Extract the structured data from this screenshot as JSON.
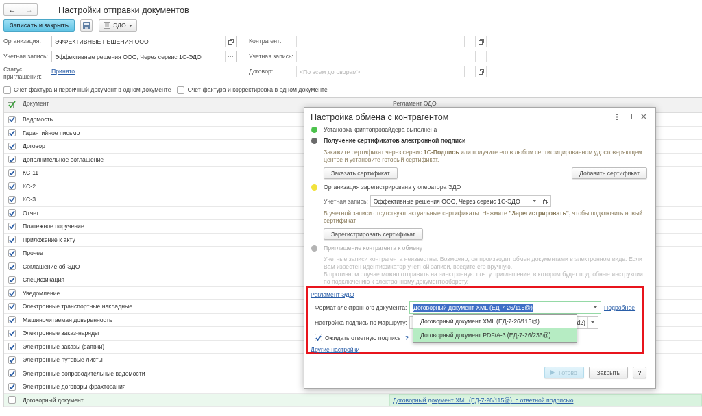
{
  "window": {
    "title": "Настройки отправки документов",
    "nav": [
      {
        "label": "←",
        "disabled": false
      },
      {
        "label": "→",
        "disabled": true
      }
    ]
  },
  "toolbar": [
    {
      "kind": "primary",
      "label": "Записать и закрыть"
    },
    {
      "kind": "save"
    },
    {
      "kind": "menu",
      "label": "ЭДО"
    }
  ],
  "form": {
    "left": [
      {
        "kind": "field",
        "label": "Организация:",
        "value": "ЭФФЕКТИВНЫЕ РЕШЕНИЯ ООО",
        "buttons": [
          {
            "kind": "open"
          }
        ]
      },
      {
        "kind": "field",
        "label": "Учетная запись:",
        "value": "Эффективные решения ООО, Через сервис 1С-ЭДО",
        "buttons": [
          {
            "kind": "more"
          }
        ]
      },
      {
        "kind": "link",
        "label": "Статус приглашения:",
        "link": "Принято"
      }
    ],
    "right": [
      {
        "kind": "field",
        "label": "Контрагент:",
        "buttons": [
          {
            "kind": "more"
          },
          {
            "kind": "open"
          }
        ]
      },
      {
        "kind": "field",
        "label": "Учетная запись:",
        "buttons": [
          {
            "kind": "more"
          }
        ]
      },
      {
        "kind": "field",
        "label": "Договор:",
        "placeholder": "<По всем договорам>",
        "buttons": [
          {
            "kind": "more"
          },
          {
            "kind": "open"
          }
        ]
      }
    ]
  },
  "options": [
    {
      "label": "Счет-фактура и первичный документ в одном документе",
      "checked": false
    },
    {
      "label": "Счет-фактура и корректировка в одном документе",
      "checked": false
    }
  ],
  "table": {
    "columns": [
      "Документ",
      "Регламент ЭДО"
    ],
    "rows": [
      {
        "document": "Ведомость",
        "checked": true,
        "selected": false
      },
      {
        "document": "Гарантийное письмо",
        "checked": true,
        "selected": false
      },
      {
        "document": "Договор",
        "checked": true,
        "selected": false
      },
      {
        "document": "Дополнительное соглашение",
        "checked": true,
        "selected": false
      },
      {
        "document": "КС-11",
        "checked": true,
        "selected": false
      },
      {
        "document": "КС-2",
        "checked": true,
        "selected": false
      },
      {
        "document": "КС-3",
        "checked": true,
        "selected": false
      },
      {
        "document": "Отчет",
        "checked": true,
        "selected": false
      },
      {
        "document": "Платежное поручение",
        "checked": true,
        "selected": false
      },
      {
        "document": "Приложение к акту",
        "checked": true,
        "selected": false
      },
      {
        "document": "Прочее",
        "checked": true,
        "selected": false
      },
      {
        "document": "Соглашение об ЭДО",
        "checked": true,
        "selected": false
      },
      {
        "document": "Спецификация",
        "checked": true,
        "selected": false
      },
      {
        "document": "Уведомление",
        "checked": true,
        "selected": false
      },
      {
        "document": "Электронные транспортные накладные",
        "checked": true,
        "selected": false
      },
      {
        "document": "Машиночитаемая доверенность",
        "checked": true,
        "selected": false
      },
      {
        "document": "Электронные заказ-наряды",
        "checked": true,
        "selected": false
      },
      {
        "document": "Электронные заказы (заявки)",
        "checked": true,
        "selected": false
      },
      {
        "document": "Электронные путевые листы",
        "checked": true,
        "selected": false
      },
      {
        "document": "Электронные сопроводительные ведомости",
        "checked": true,
        "selected": false
      },
      {
        "document": "Электронные договоры фрахтования",
        "checked": true,
        "selected": false
      },
      {
        "document": "Договорный документ",
        "checked": false,
        "selected": true,
        "regulation": "Договорный документ XML (ЕД-7-26/115@), с ответной подписью"
      }
    ]
  },
  "dialog": {
    "title": "Настройка обмена с контрагентом",
    "steps": [
      {
        "title": "Установка криптопровайдера выполнена",
        "color": "#4cc24c",
        "current": false,
        "disabled": false
      },
      {
        "title": "Получение сертификатов электронной подписи",
        "color": "#6b6b6b",
        "current": true,
        "disabled": false,
        "paragraphs": [
          "Закажите сертификат через сервис **1С-Подпись** или получите его в любом сертифицированном удостоверяющем центре и установите готовый сертификат."
        ],
        "buttons": [
          "Заказать сертификат",
          "Добавить сертификат"
        ]
      },
      {
        "title": "Организация зарегистрирована у оператора ЭДО",
        "color": "#f2e23c",
        "current": false,
        "disabled": false,
        "account": {
          "label": "Учетная запись:",
          "value": "Эффективные решения ООО, Через сервис 1С-ЭДО",
          "buttons": [
            {
              "kind": "dropdown"
            },
            {
              "kind": "open"
            }
          ]
        },
        "paragraphs": [
          "В учетной записи отсутствуют актуальные сертификаты. Нажмите **\"Зарегистрировать\",** чтобы подключить новый сертификат."
        ],
        "buttons": [
          "Зарегистрировать сертификат"
        ]
      },
      {
        "title": "Приглашение контрагента к обмену",
        "color": "#b4b4b4",
        "current": false,
        "disabled": true,
        "paragraphs": [
          "Учетные записи контрагента неизвестны. Возможно, он производит обмен документами в электронном виде. Если Вам известен идентификатор учетной записи, введите его вручную.",
          "В противном случае можно отправить на электронную почту приглашение, в котором будет подробные инструкции по подключению к электронному документообороту."
        ]
      }
    ],
    "regulation": {
      "link": "Регламент ЭДО",
      "format": {
        "label": "Формат электронного документа:",
        "value": "Договорный документ XML (ЕД-7-26/115@)",
        "focused": true,
        "buttons": [
          {
            "kind": "dropdown"
          }
        ],
        "more": "Подробнее"
      },
      "route": {
        "label": "Настройка подпись по маршруту:",
        "value": "d2)",
        "buttons": [
          {
            "kind": "dropdown"
          }
        ]
      },
      "wait": {
        "label": "Ожидать ответную подпись",
        "checked": true,
        "help": "?"
      },
      "other": "Другие настройки",
      "dropdown": [
        {
          "label": "Договорный документ XML (ЕД-7-26/115@)",
          "selected": false
        },
        {
          "label": "Договорный документ PDF/A-3 (ЕД-7-26/236@)",
          "selected": true
        }
      ]
    },
    "buttons": [
      {
        "kind": "primary",
        "label": "Готово",
        "disabled": true
      },
      {
        "kind": "default",
        "label": "Закрыть"
      },
      {
        "kind": "help",
        "label": "?"
      }
    ]
  }
}
